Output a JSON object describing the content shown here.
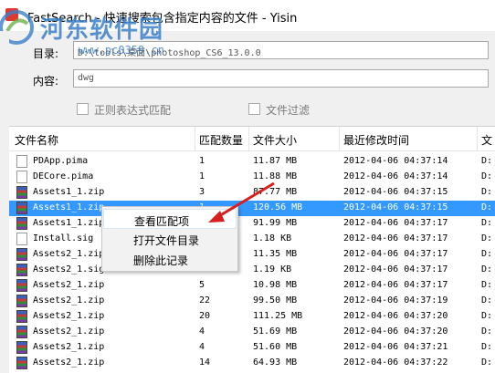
{
  "window": {
    "title": "FastSearch - 快速搜索包含指定内容的文件 - Yisin"
  },
  "watermark": {
    "brand": "河东软件园",
    "url": "www.pc0359.cn"
  },
  "form": {
    "dir_label": "目录:",
    "dir_value": "D:\\tools\\桌面\\photoshop_CS6_13.0.0",
    "content_label": "内容:",
    "content_value": "dwg",
    "regex_label": "正则表达式匹配",
    "filter_label": "文件过滤"
  },
  "table": {
    "columns": [
      "文件名称",
      "匹配数量",
      "文件大小",
      "最近修改时间",
      "文"
    ],
    "rows": [
      {
        "icon": "doc",
        "name": "PDApp.pima",
        "count": "1",
        "size": "11.87 MB",
        "time": "2012-04-06 04:37:14",
        "path": "D:"
      },
      {
        "icon": "doc",
        "name": "DECore.pima",
        "count": "1",
        "size": "11.88 MB",
        "time": "2012-04-06 04:37:14",
        "path": "D:"
      },
      {
        "icon": "zip",
        "name": "Assets1_1.zip",
        "count": "3",
        "size": "87.77 MB",
        "time": "2012-04-06 04:37:15",
        "path": "D:"
      },
      {
        "icon": "zip",
        "name": "Assets1_1.zip",
        "count": "1",
        "size": "120.56 MB",
        "time": "2012-04-06 04:37:15",
        "path": "D:",
        "selected": true
      },
      {
        "icon": "zip",
        "name": "Assets1_1.zip",
        "count": "",
        "size": "91.99 MB",
        "time": "2012-04-06 04:37:17",
        "path": "D:"
      },
      {
        "icon": "doc",
        "name": "Install.sig",
        "count": "",
        "size": "1.18 KB",
        "time": "2012-04-06 04:37:17",
        "path": "D:"
      },
      {
        "icon": "zip",
        "name": "Assets2_1.zip",
        "count": "",
        "size": "11.35 MB",
        "time": "2012-04-06 04:37:17",
        "path": "D:"
      },
      {
        "icon": "zip",
        "name": "Assets2_1.sig",
        "count": "",
        "size": "1.19 KB",
        "time": "2012-04-06 04:37:17",
        "path": "D:"
      },
      {
        "icon": "zip",
        "name": "Assets2_1.zip",
        "count": "5",
        "size": "10.98 MB",
        "time": "2012-04-06 04:37:17",
        "path": "D:"
      },
      {
        "icon": "zip",
        "name": "Assets2_1.zip",
        "count": "22",
        "size": "99.50 MB",
        "time": "2012-04-06 04:37:19",
        "path": "D:"
      },
      {
        "icon": "zip",
        "name": "Assets2_1.zip",
        "count": "20",
        "size": "111.25 MB",
        "time": "2012-04-06 04:37:20",
        "path": "D:"
      },
      {
        "icon": "zip",
        "name": "Assets2_1.zip",
        "count": "4",
        "size": "51.69 MB",
        "time": "2012-04-06 04:37:20",
        "path": "D:"
      },
      {
        "icon": "zip",
        "name": "Assets2_1.zip",
        "count": "4",
        "size": "51.60 MB",
        "time": "2012-04-06 04:37:21",
        "path": "D:"
      },
      {
        "icon": "zip",
        "name": "Assets2_1.zip",
        "count": "14",
        "size": "64.93 MB",
        "time": "2012-04-06 04:37:22",
        "path": "D:"
      }
    ]
  },
  "context_menu": {
    "items": [
      "查看匹配项",
      "打开文件目录",
      "删除此记录"
    ]
  },
  "colors": {
    "selection": "#3399ff",
    "watermark": "#3a7fc9",
    "arrow": "#d62020"
  }
}
